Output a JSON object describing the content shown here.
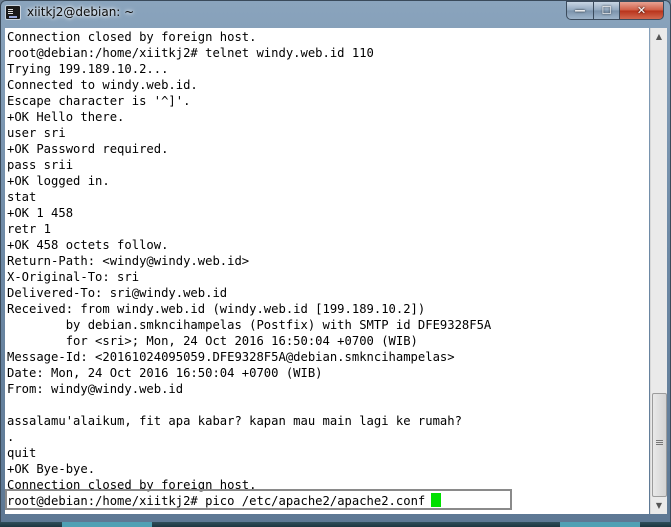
{
  "window": {
    "title": "xiitkj2@debian: ~",
    "controls": {
      "minimize": "—",
      "maximize": "☐",
      "close": "✕"
    }
  },
  "colors": {
    "terminal_bg": "#ffffff",
    "terminal_fg": "#000000",
    "cursor": "#00e000"
  },
  "terminal": {
    "lines": [
      "Connection closed by foreign host.",
      "root@debian:/home/xiitkj2# telnet windy.web.id 110",
      "Trying 199.189.10.2...",
      "Connected to windy.web.id.",
      "Escape character is '^]'.",
      "+OK Hello there.",
      "user sri",
      "+OK Password required.",
      "pass srii",
      "+OK logged in.",
      "stat",
      "+OK 1 458",
      "retr 1",
      "+OK 458 octets follow.",
      "Return-Path: <windy@windy.web.id>",
      "X-Original-To: sri",
      "Delivered-To: sri@windy.web.id",
      "Received: from windy.web.id (windy.web.id [199.189.10.2])",
      "        by debian.smkncihampelas (Postfix) with SMTP id DFE9328F5A",
      "        for <sri>; Mon, 24 Oct 2016 16:50:04 +0700 (WIB)",
      "Message-Id: <20161024095059.DFE9328F5A@debian.smkncihampelas>",
      "Date: Mon, 24 Oct 2016 16:50:04 +0700 (WIB)",
      "From: windy@windy.web.id",
      "",
      "assalamu'alaikum, fit apa kabar? kapan mau main lagi ke rumah?",
      ".",
      "quit",
      "+OK Bye-bye.",
      "Connection closed by foreign host."
    ],
    "prompt": "root@debian:/home/xiitkj2#",
    "command": "pico /etc/apache2/apache2.conf"
  },
  "scrollbar": {
    "up_icon": "up-arrow-icon",
    "down_icon": "down-arrow-icon"
  }
}
